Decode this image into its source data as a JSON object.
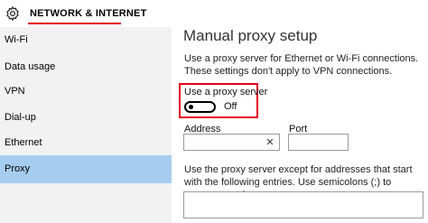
{
  "header": {
    "title": "NETWORK & INTERNET",
    "icon": "gear-icon"
  },
  "sidebar": {
    "items": [
      {
        "label": "Wi-Fi"
      },
      {
        "label": "Data usage"
      },
      {
        "label": "VPN"
      },
      {
        "label": "Dial-up"
      },
      {
        "label": "Ethernet"
      },
      {
        "label": "Proxy",
        "active": true
      }
    ]
  },
  "main": {
    "title": "Manual proxy setup",
    "description": "Use a proxy server for Ethernet or Wi-Fi connections. These settings don't apply to VPN connections.",
    "use_proxy": {
      "label": "Use a proxy server",
      "state": "Off"
    },
    "address": {
      "label": "Address",
      "value": ""
    },
    "port": {
      "label": "Port",
      "value": ""
    },
    "exceptions": {
      "description": "Use the proxy server except for addresses that start with the following entries. Use semicolons (;) to separate entries.",
      "value": ""
    }
  },
  "colors": {
    "accent_highlight": "#e3001b",
    "active_nav": "#a6cdf0",
    "sidebar_bg": "#f2f2f2"
  }
}
